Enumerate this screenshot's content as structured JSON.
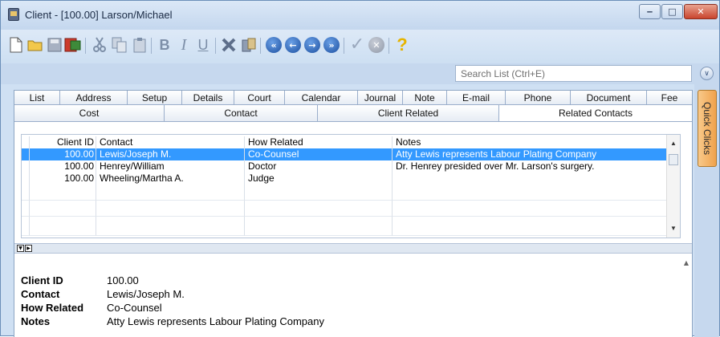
{
  "window": {
    "title": "Client - [100.00] Larson/Michael",
    "controls": {
      "minimize": "‒",
      "maximize": "□",
      "close": "✕"
    }
  },
  "toolbar": {
    "icons": [
      "new-icon",
      "open-folder-icon",
      "save-icon",
      "save-close-icon",
      "cut-icon",
      "copy-icon",
      "paste-icon",
      "bold-icon",
      "italic-icon",
      "underline-icon",
      "delete-icon",
      "attach-icon",
      "first-record-icon",
      "previous-record-icon",
      "next-record-icon",
      "last-record-icon",
      "check-icon",
      "cancel-icon",
      "help-icon"
    ],
    "bold_label": "B",
    "italic_label": "I",
    "underline_label": "U",
    "help_label": "?"
  },
  "search": {
    "placeholder": "Search List (Ctrl+E)"
  },
  "tabs_row1": [
    "List",
    "Address",
    "Setup",
    "Details",
    "Court",
    "Calendar",
    "Journal",
    "Note",
    "E-mail",
    "Phone",
    "Document",
    "Fee"
  ],
  "tabs_row2": [
    "Cost",
    "Contact",
    "Client Related",
    "Related Contacts"
  ],
  "active_tab": "Related Contacts",
  "grid": {
    "headers": [
      "Client ID",
      "Contact",
      "How Related",
      "Notes"
    ],
    "rows": [
      [
        "100.00",
        "Lewis/Joseph M.",
        "Co-Counsel",
        "Atty Lewis represents Labour Plating Company"
      ],
      [
        "100.00",
        "Henrey/William",
        "Doctor",
        "Dr. Henrey presided over Mr. Larson's surgery."
      ],
      [
        "100.00",
        "Wheeling/Martha A.",
        "Judge",
        ""
      ]
    ],
    "selected_row": 0
  },
  "detail": {
    "labels": {
      "client_id": "Client ID",
      "contact": "Contact",
      "how_related": "How Related",
      "notes": "Notes"
    },
    "values": {
      "client_id": "100.00",
      "contact": "Lewis/Joseph M.",
      "how_related": "Co-Counsel",
      "notes": "Atty Lewis represents Labour Plating Company"
    }
  },
  "quick_clicks": "Quick Clicks",
  "colors": {
    "selection": "#3399ff",
    "quick_clicks": "#f0a24c",
    "frame": "#cfe0f3"
  }
}
